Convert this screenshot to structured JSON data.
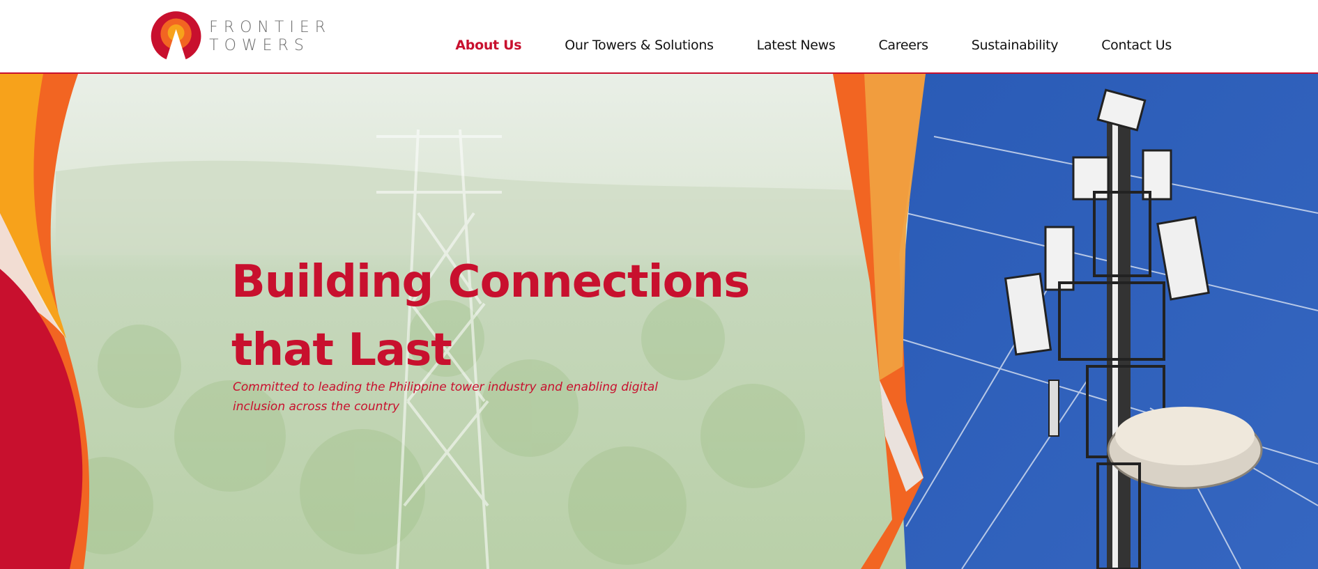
{
  "brand": {
    "line1": "FRONTIER",
    "line2": "TOWERS",
    "colors": {
      "red": "#c8102e",
      "orange": "#f26522",
      "amber": "#f7a21b"
    }
  },
  "nav": {
    "items": [
      {
        "label": "About Us",
        "active": true
      },
      {
        "label": "Our Towers & Solutions",
        "active": false
      },
      {
        "label": "Latest News",
        "active": false
      },
      {
        "label": "Careers",
        "active": false
      },
      {
        "label": "Sustainability",
        "active": false
      },
      {
        "label": "Contact Us",
        "active": false
      }
    ]
  },
  "hero": {
    "headline_line1": "Building Connections",
    "headline_line2": "that Last",
    "subheadline": "Committed to leading the Philippine tower industry and enabling digital inclusion across the country",
    "accent_color": "#c8102e",
    "sky_color": "#2f5fb8"
  }
}
